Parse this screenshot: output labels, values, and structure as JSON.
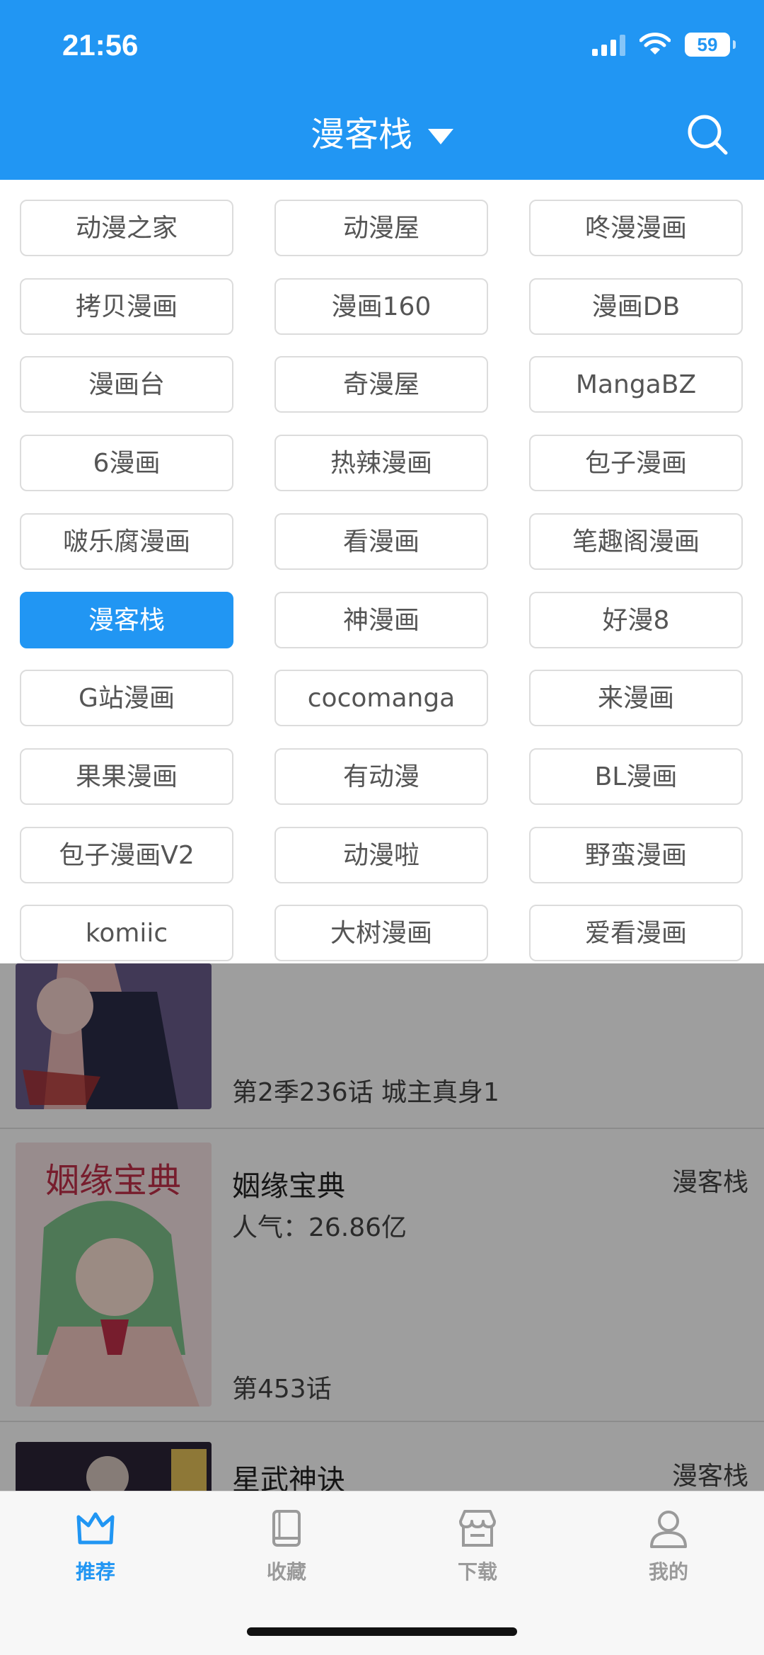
{
  "status_bar": {
    "time": "21:56",
    "battery": "59"
  },
  "header": {
    "title": "漫客栈"
  },
  "sources": [
    "动漫之家",
    "动漫屋",
    "咚漫漫画",
    "拷贝漫画",
    "漫画160",
    "漫画DB",
    "漫画台",
    "奇漫屋",
    "MangaBZ",
    "6漫画",
    "热辣漫画",
    "包子漫画",
    "啵乐腐漫画",
    "看漫画",
    "笔趣阁漫画",
    "漫客栈",
    "神漫画",
    "好漫8",
    "G站漫画",
    "cocomanga",
    "来漫画",
    "果果漫画",
    "有动漫",
    "BL漫画",
    "包子漫画V2",
    "动漫啦",
    "野蛮漫画",
    "komiic",
    "大树漫画",
    "爱看漫画"
  ],
  "selected_source": "漫客栈",
  "comics": [
    {
      "title": "",
      "popularity": "",
      "chapter": "第2季236话 城主真身1",
      "source": ""
    },
    {
      "title": "姻缘宝典",
      "popularity": "人气：26.86亿",
      "chapter": "第453话",
      "source": "漫客栈",
      "cover_text": "姻缘宝典"
    },
    {
      "title": "星武神诀",
      "popularity": "",
      "chapter": "",
      "source": "漫客栈"
    }
  ],
  "tabs": [
    {
      "label": "推荐",
      "icon": "crown-icon",
      "active": true
    },
    {
      "label": "收藏",
      "icon": "book-icon",
      "active": false
    },
    {
      "label": "下载",
      "icon": "store-icon",
      "active": false
    },
    {
      "label": "我的",
      "icon": "person-icon",
      "active": false
    }
  ],
  "colors": {
    "accent": "#2196f3",
    "inactive": "#9a9a9a"
  }
}
